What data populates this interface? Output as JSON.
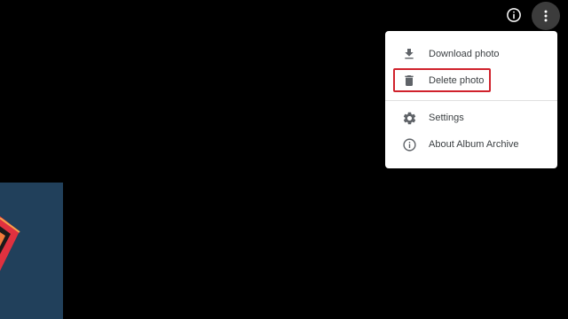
{
  "toolbar": {
    "info_icon": "info-icon",
    "more_icon": "more-vert-icon"
  },
  "menu": {
    "items": [
      {
        "label": "Download photo",
        "icon": "download-icon"
      },
      {
        "label": "Delete photo",
        "icon": "trash-icon"
      },
      {
        "label": "Settings",
        "icon": "gear-icon"
      },
      {
        "label": "About Album Archive",
        "icon": "info-icon"
      }
    ]
  },
  "colors": {
    "background": "#000000",
    "menu_background": "#ffffff",
    "menu_text": "#3c4043",
    "icon_gray": "#5f6368",
    "highlight": "#d0222c",
    "more_button_bg": "#3c3c3c",
    "thumbnail_bg": "#1f3b57",
    "thumbnail_accent": "#e0313f"
  }
}
